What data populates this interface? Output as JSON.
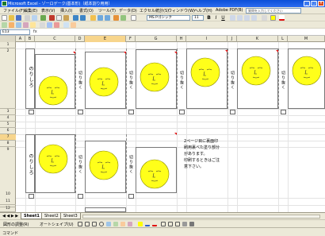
{
  "window": {
    "title": "Microsoft Excel - ゾーロゲーク(基本形)（紙本割り用用）",
    "controls": [
      "_",
      "□",
      "×"
    ]
  },
  "menu": {
    "items": [
      "ファイル(F)",
      "編集(E)",
      "表示(V)",
      "挿入(I)",
      "書式(O)",
      "ツール(T)",
      "データ(D)",
      "エクセル統計(S)",
      "ウィンドウ(W)",
      "ヘルプ(H)",
      "Adobe PDF(B)"
    ],
    "help_placeholder": "質問を入力してください"
  },
  "format_toolbar": {
    "font": "MS Pゴシック",
    "size": "11",
    "buttons": [
      "B",
      "I",
      "U"
    ]
  },
  "formula_bar": {
    "namebox": "E13",
    "fx": "fx"
  },
  "columns": [
    "A",
    "B",
    "C",
    "D",
    "E",
    "F",
    "G",
    "H",
    "I",
    "J",
    "K",
    "L",
    "M"
  ],
  "rows": [
    "1",
    "2",
    "3",
    "4",
    "5",
    "6",
    "7",
    "8",
    "9",
    "10",
    "11",
    "12"
  ],
  "sheet": {
    "glue_label": "のりしろ",
    "cut_label": "切り抜く",
    "note": "2ページ目に裏面印\n刷用裏べた塗り部分\nがあります。\n印刷するときはご注\n意下さい。"
  },
  "sheet_tabs": {
    "nav": "◀ ◀ ▶ ▶",
    "tabs": [
      "Sheet1",
      "Sheet2",
      "Sheet3"
    ],
    "active": 0
  },
  "draw_toolbar": {
    "draw": "図形の調整(R)",
    "autoshape": "オートシェイプ(U)"
  },
  "status": {
    "text": "コマンド"
  },
  "colors": {
    "face_fill": "#ffff1a",
    "face_stroke": "#8a8a00",
    "titlebar": "#0a4fd8",
    "mark": "#e01010"
  }
}
